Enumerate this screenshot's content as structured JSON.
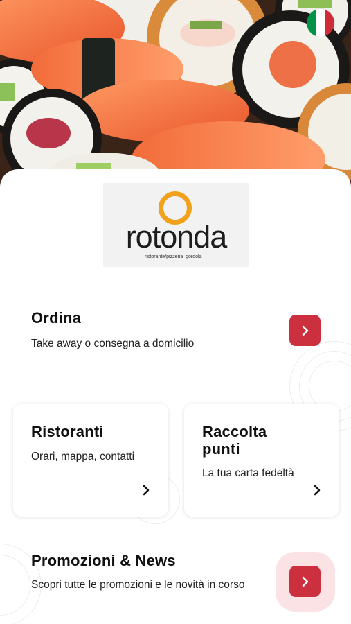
{
  "hero": {
    "image_alt": "Sushi assortment"
  },
  "language": {
    "icon": "italy-flag-icon",
    "colors": [
      "#009246",
      "#ffffff",
      "#ce2b37"
    ]
  },
  "logo": {
    "name": "rotonda",
    "tagline": "ristorante/pizzeria–gordola",
    "ring_color": "#f0a21c"
  },
  "accent_color": "#cc2f3e",
  "ordina": {
    "title": "Ordina",
    "subtitle": "Take away o consegna a domicilio",
    "button_icon": "chevron-right-icon"
  },
  "ristoranti": {
    "title": "Ristoranti",
    "subtitle": "Orari, mappa, contatti",
    "icon": "chevron-right-icon"
  },
  "raccolta": {
    "title": "Raccolta punti",
    "subtitle": "La tua carta fedeltà",
    "icon": "chevron-right-icon"
  },
  "promozioni": {
    "title": "Promozioni & News",
    "subtitle": "Scopri tutte le promozioni e le novità in corso",
    "button_icon": "chevron-right-icon"
  }
}
